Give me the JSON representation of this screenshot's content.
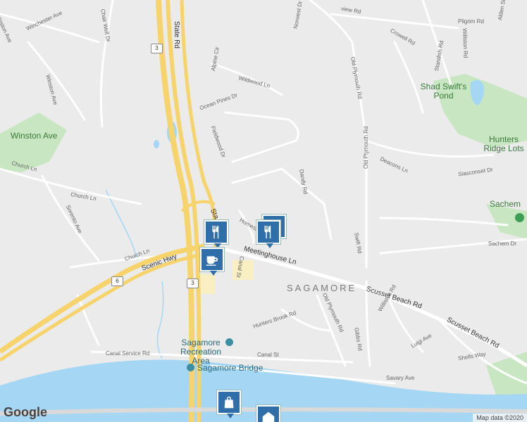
{
  "map": {
    "water_color": "#a5d7f5",
    "park_color": "#c8e6c1",
    "highway_color": "#f6d36b",
    "road_color": "#ffffff",
    "marker_color": "#2f6ea8"
  },
  "roads": {
    "state_rd": "State Rd",
    "state_rd_short": "Sta",
    "winston_ave_top": "Winston Ave",
    "winchester_ave": "Winchester Ave",
    "winston_ave_side": "Winston Ave",
    "chair_well_dr": "Chair Well Dr",
    "alpine_cir": "Alpine Cir",
    "ocean_pines_dr": "Ocean Pines Dr",
    "wildwood_ln": "Wildwood Ln",
    "fieldwood_dr": "Fieldwood Dr",
    "norwest_dr": "Norwest Dr",
    "view_rd": "view Rd",
    "crowell_rd": "Crowell Rd",
    "pilgrim_rd": "Pilgrim Rd",
    "alden_st": "Alden St",
    "standish_rd": "Standish Rd",
    "williston_rd_top": "Williston Rd",
    "old_plymouth_rd_1": "Old Plymouth Rd",
    "old_plymouth_rd_2": "Old Plymouth Rd",
    "old_plymouth_rd_3": "Old Plymouth Rd",
    "deacons_ln": "Deacons Ln",
    "siasconset_dr": "Siasconset Dr",
    "sachem_dr": "Sachem Dr",
    "dandy_rd": "Dandy Rd",
    "swift_rd": "Swift Rd",
    "church_ln_1": "Church Ln",
    "church_ln_2": "Church Ln",
    "sorento_ave": "Sorento Ave",
    "homestead": "Homestead",
    "scenic_hwy": "Scenic Hwy",
    "meetinghouse_ln": "Meetinghouse Ln",
    "canal_st_v": "Canal St",
    "scusset_beach_rd_1": "Scusset Beach Rd",
    "scusset_beach_rd_2": "Scusset Beach Rd",
    "scusset_beach_rd_3": "Scusset Beach Rd",
    "hunters_brook_rd": "Hunters Brook Rd",
    "gibbs_rd": "Gibbs Rd",
    "williston_rd_bottom": "Williston Rd",
    "luigi_ave": "Luigi Ave",
    "shells_way": "Shells Way",
    "savary_ave": "Savary Ave",
    "canal_service_rd": "Canal Service Rd",
    "canal_st": "Canal St"
  },
  "shields": {
    "route3_top": "3",
    "route3_bottom": "3",
    "route6": "6"
  },
  "places": {
    "winston_ave": "Winston Ave",
    "shad_swifts_pond": "Shad Swift's Pond",
    "hunters_ridge_lots": "Hunters Ridge Lots",
    "sachem": "Sachem",
    "sagamore": "SAGAMORE",
    "sagamore_recreation_area": "Sagamore Recreation Area",
    "sagamore_bridge": "Sagamore Bridge"
  },
  "markers": [
    {
      "icon": "restaurant-icon"
    },
    {
      "icon": "restaurant-icon"
    },
    {
      "icon": "restaurant-icon"
    },
    {
      "icon": "cafe-icon"
    },
    {
      "icon": "shopping-bag-icon"
    },
    {
      "icon": "lodging-icon"
    }
  ],
  "footer": {
    "google_logo": "Google",
    "map_data": "Map data ©2020"
  }
}
